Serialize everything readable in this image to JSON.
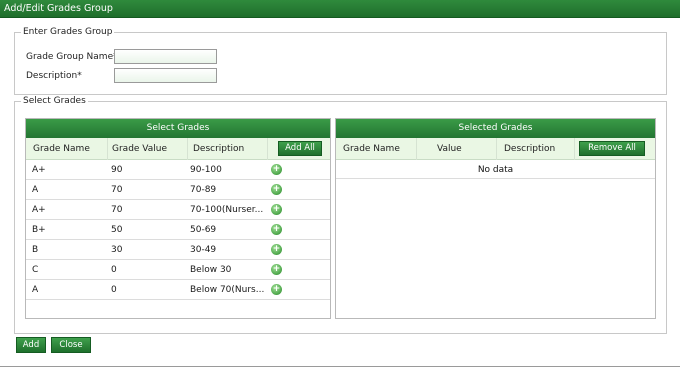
{
  "window": {
    "title": "Add/Edit Grades Group"
  },
  "enter_section": {
    "legend": "Enter Grades Group",
    "name_label": "Grade Group Name*",
    "name_value": "",
    "description_label": "Description*",
    "description_value": ""
  },
  "select_section": {
    "legend": "Select Grades",
    "available": {
      "title": "Select Grades",
      "columns": [
        "Grade Name",
        "Grade Value",
        "Description"
      ],
      "add_all_label": "Add All",
      "rows": [
        {
          "name": "A+",
          "value": "90",
          "description": "90-100"
        },
        {
          "name": "A",
          "value": "70",
          "description": "70-89"
        },
        {
          "name": "A+",
          "value": "70",
          "description": "70-100(Nurser..."
        },
        {
          "name": "B+",
          "value": "50",
          "description": "50-69"
        },
        {
          "name": "B",
          "value": "30",
          "description": "30-49"
        },
        {
          "name": "C",
          "value": "0",
          "description": "Below 30"
        },
        {
          "name": "A",
          "value": "0",
          "description": "Below 70(Nurs..."
        }
      ]
    },
    "selected": {
      "title": "Selected Grades",
      "columns": [
        "Grade Name",
        "Value",
        "Description"
      ],
      "remove_all_label": "Remove All",
      "empty_text": "No data"
    }
  },
  "footer": {
    "add_label": "Add",
    "close_label": "Close"
  },
  "icons": {
    "row_add": "plus-circle-icon"
  },
  "colors": {
    "accent": "#2a8038",
    "header_bg": "#eaf7e4"
  }
}
